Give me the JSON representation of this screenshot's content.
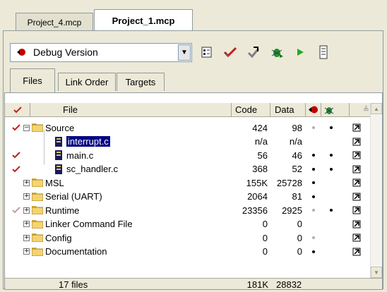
{
  "doc_tabs": [
    {
      "label": "Project_4.mcp",
      "active": false
    },
    {
      "label": "Project_1.mcp",
      "active": true
    }
  ],
  "toolbar": {
    "target": "Debug Version",
    "buttons": [
      "settings-icon",
      "check-icon",
      "sync-icon",
      "debug-icon",
      "run-icon",
      "project-icon"
    ]
  },
  "view_tabs": [
    {
      "label": "Files",
      "active": true
    },
    {
      "label": "Link Order",
      "active": false
    },
    {
      "label": "Targets",
      "active": false
    }
  ],
  "columns": {
    "file": "File",
    "code": "Code",
    "data": "Data"
  },
  "rows": [
    {
      "name": "Source",
      "kind": "folder",
      "expanded": true,
      "check": "red",
      "code": "424",
      "data": "98",
      "dbg": "gray",
      "dep": "black"
    },
    {
      "name": "interrupt.c",
      "kind": "file",
      "selected": true,
      "check": "",
      "code": "n/a",
      "data": "n/a",
      "dbg": "",
      "dep": ""
    },
    {
      "name": "main.c",
      "kind": "file",
      "check": "red",
      "code": "56",
      "data": "46",
      "dbg": "black",
      "dep": "black"
    },
    {
      "name": "sc_handler.c",
      "kind": "file",
      "check": "red",
      "code": "368",
      "data": "52",
      "dbg": "black",
      "dep": "black"
    },
    {
      "name": "MSL",
      "kind": "folder",
      "check": "",
      "code": "155K",
      "data": "25728",
      "dbg": "black",
      "dep": ""
    },
    {
      "name": "Serial (UART)",
      "kind": "folder",
      "check": "",
      "code": "2064",
      "data": "81",
      "dbg": "black",
      "dep": ""
    },
    {
      "name": "Runtime",
      "kind": "folder",
      "check": "gray",
      "code": "23356",
      "data": "2925",
      "dbg": "gray",
      "dep": "black"
    },
    {
      "name": "Linker Command File",
      "kind": "folder",
      "check": "",
      "code": "0",
      "data": "0",
      "dbg": "",
      "dep": ""
    },
    {
      "name": "Config",
      "kind": "folder",
      "check": "",
      "code": "0",
      "data": "0",
      "dbg": "gray",
      "dep": ""
    },
    {
      "name": "Documentation",
      "kind": "folder",
      "check": "",
      "code": "0",
      "data": "0",
      "dbg": "black",
      "dep": ""
    }
  ],
  "footer": {
    "files": "17 files",
    "code": "181K",
    "data": "28832"
  }
}
